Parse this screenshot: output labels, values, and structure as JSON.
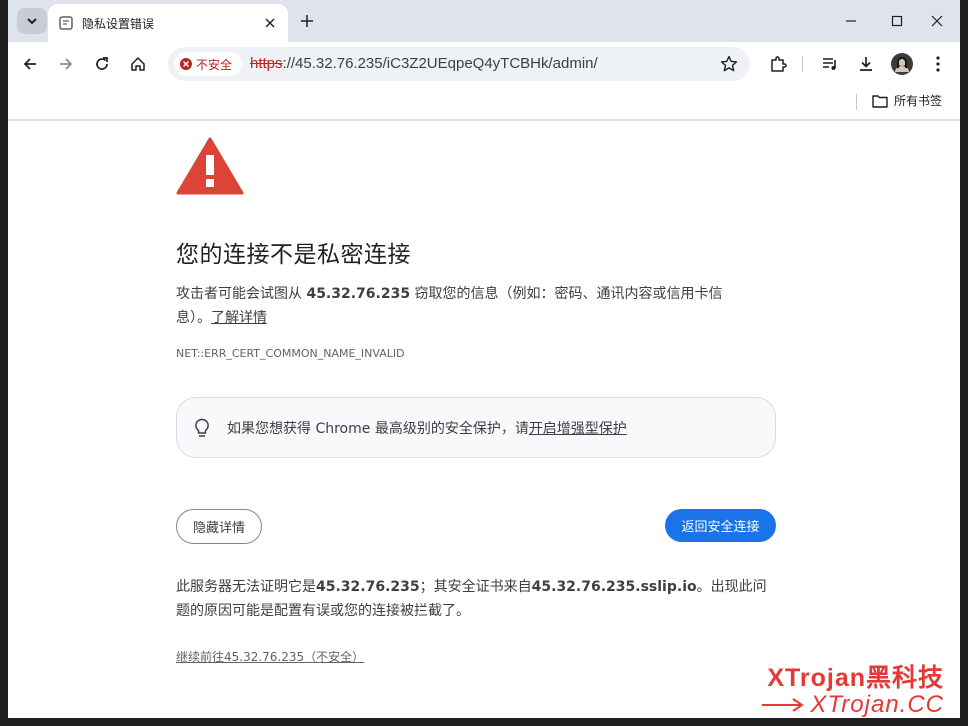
{
  "tab": {
    "title": "隐私设置错误"
  },
  "omnibox": {
    "security_label": "不安全",
    "url_scheme": "https",
    "url_rest": "://45.32.76.235/iC3Z2UEqpeQ4yTCBHk/admin/"
  },
  "bookmarks": {
    "all_label": "所有书签"
  },
  "page": {
    "heading": "您的连接不是私密连接",
    "desc_prefix": "攻击者可能会试图从 ",
    "desc_host": "45.32.76.235",
    "desc_suffix": " 窃取您的信息（例如：密码、通讯内容或信用卡信息）。",
    "learn_more": "了解详情",
    "error_code": "NET::ERR_CERT_COMMON_NAME_INVALID",
    "enhanced_prefix": "如果您想获得 Chrome 最高级别的安全保护，请",
    "enhanced_link": "开启增强型保护",
    "hide_details": "隐藏详情",
    "back_to_safety": "返回安全连接",
    "explain_1": "此服务器无法证明它是",
    "explain_host": "45.32.76.235",
    "explain_2": "；其安全证书来自",
    "explain_cert": "45.32.76.235.sslip.io",
    "explain_3": "。出现此问题的原因可能是配置有误或您的连接被拦截了。",
    "proceed": "继续前往45.32.76.235（不安全）"
  },
  "watermark": {
    "line1": "XTrojan黑科技",
    "line2": "XTrojan.CC"
  },
  "colors": {
    "accent": "#1a73e8",
    "danger": "#db4437",
    "watermark": "#e53935"
  }
}
